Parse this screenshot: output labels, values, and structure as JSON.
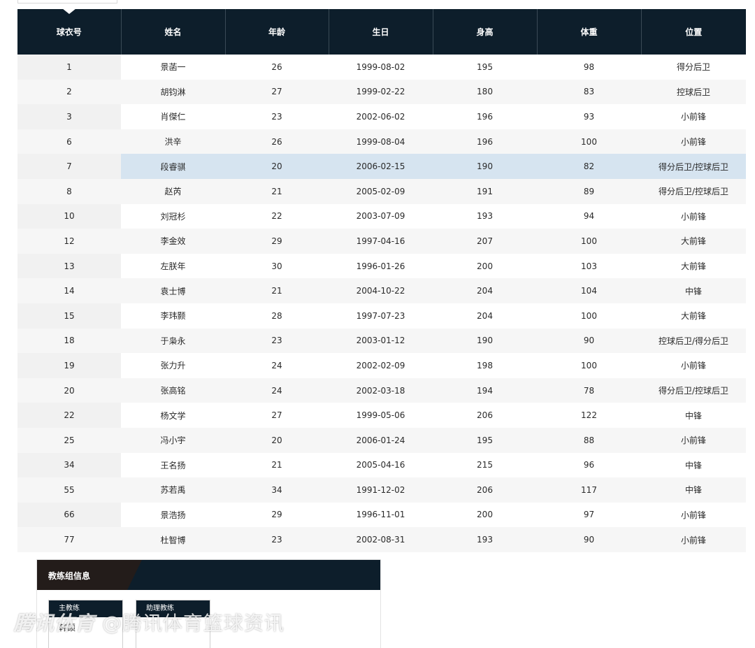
{
  "table": {
    "headers": [
      "球衣号",
      "姓名",
      "年龄",
      "生日",
      "身高",
      "体重",
      "位置"
    ],
    "rows": [
      {
        "number": "1",
        "name": "景菡一",
        "age": "26",
        "birthday": "1999-08-02",
        "height": "195",
        "weight": "98",
        "position": "得分后卫"
      },
      {
        "number": "2",
        "name": "胡钧淋",
        "age": "27",
        "birthday": "1999-02-22",
        "height": "180",
        "weight": "83",
        "position": "控球后卫"
      },
      {
        "number": "3",
        "name": "肖傑仁",
        "age": "23",
        "birthday": "2002-06-02",
        "height": "196",
        "weight": "93",
        "position": "小前锋"
      },
      {
        "number": "6",
        "name": "洪辛",
        "age": "26",
        "birthday": "1999-08-04",
        "height": "196",
        "weight": "100",
        "position": "小前锋"
      },
      {
        "number": "7",
        "name": "段睿骐",
        "age": "20",
        "birthday": "2006-02-15",
        "height": "190",
        "weight": "82",
        "position": "得分后卫/控球后卫"
      },
      {
        "number": "8",
        "name": "赵芮",
        "age": "21",
        "birthday": "2005-02-09",
        "height": "191",
        "weight": "89",
        "position": "得分后卫/控球后卫"
      },
      {
        "number": "10",
        "name": "刘冠杉",
        "age": "22",
        "birthday": "2003-07-09",
        "height": "193",
        "weight": "94",
        "position": "小前锋"
      },
      {
        "number": "12",
        "name": "李金效",
        "age": "29",
        "birthday": "1997-04-16",
        "height": "207",
        "weight": "100",
        "position": "大前锋"
      },
      {
        "number": "13",
        "name": "左朕年",
        "age": "30",
        "birthday": "1996-01-26",
        "height": "200",
        "weight": "103",
        "position": "大前锋"
      },
      {
        "number": "14",
        "name": "袁士博",
        "age": "21",
        "birthday": "2004-10-22",
        "height": "204",
        "weight": "104",
        "position": "中锋"
      },
      {
        "number": "15",
        "name": "李玮颢",
        "age": "28",
        "birthday": "1997-07-23",
        "height": "204",
        "weight": "100",
        "position": "大前锋"
      },
      {
        "number": "18",
        "name": "于枭永",
        "age": "23",
        "birthday": "2003-01-12",
        "height": "190",
        "weight": "90",
        "position": "控球后卫/得分后卫"
      },
      {
        "number": "19",
        "name": "张力升",
        "age": "24",
        "birthday": "2002-02-09",
        "height": "198",
        "weight": "100",
        "position": "小前锋"
      },
      {
        "number": "20",
        "name": "张高铭",
        "age": "24",
        "birthday": "2002-03-18",
        "height": "194",
        "weight": "78",
        "position": "得分后卫/控球后卫"
      },
      {
        "number": "22",
        "name": "杨文学",
        "age": "27",
        "birthday": "1999-05-06",
        "height": "206",
        "weight": "122",
        "position": "中锋"
      },
      {
        "number": "25",
        "name": "冯小宇",
        "age": "20",
        "birthday": "2006-01-24",
        "height": "195",
        "weight": "88",
        "position": "小前锋"
      },
      {
        "number": "34",
        "name": "王名扬",
        "age": "21",
        "birthday": "2005-04-16",
        "height": "215",
        "weight": "96",
        "position": "中锋"
      },
      {
        "number": "55",
        "name": "苏若禹",
        "age": "34",
        "birthday": "1991-12-02",
        "height": "206",
        "weight": "117",
        "position": "中锋"
      },
      {
        "number": "66",
        "name": "景浩扬",
        "age": "29",
        "birthday": "1996-11-01",
        "height": "200",
        "weight": "97",
        "position": "小前锋"
      },
      {
        "number": "77",
        "name": "杜智博",
        "age": "23",
        "birthday": "2002-08-31",
        "height": "193",
        "weight": "90",
        "position": "小前锋"
      }
    ],
    "highlighted_row_index": 4
  },
  "coach": {
    "title": "教练组信息",
    "cards": [
      {
        "role": "主教练",
        "name": "韩硕"
      },
      {
        "role": "助理教练",
        "name": ""
      }
    ]
  },
  "watermark": {
    "brand": "腾讯体育",
    "handle": "@腾讯体育篮球资讯"
  },
  "colors": {
    "header_bg": "#0d1e2b",
    "highlight_row": "#d6e4f0",
    "alt_row": "#f6f6f6"
  }
}
